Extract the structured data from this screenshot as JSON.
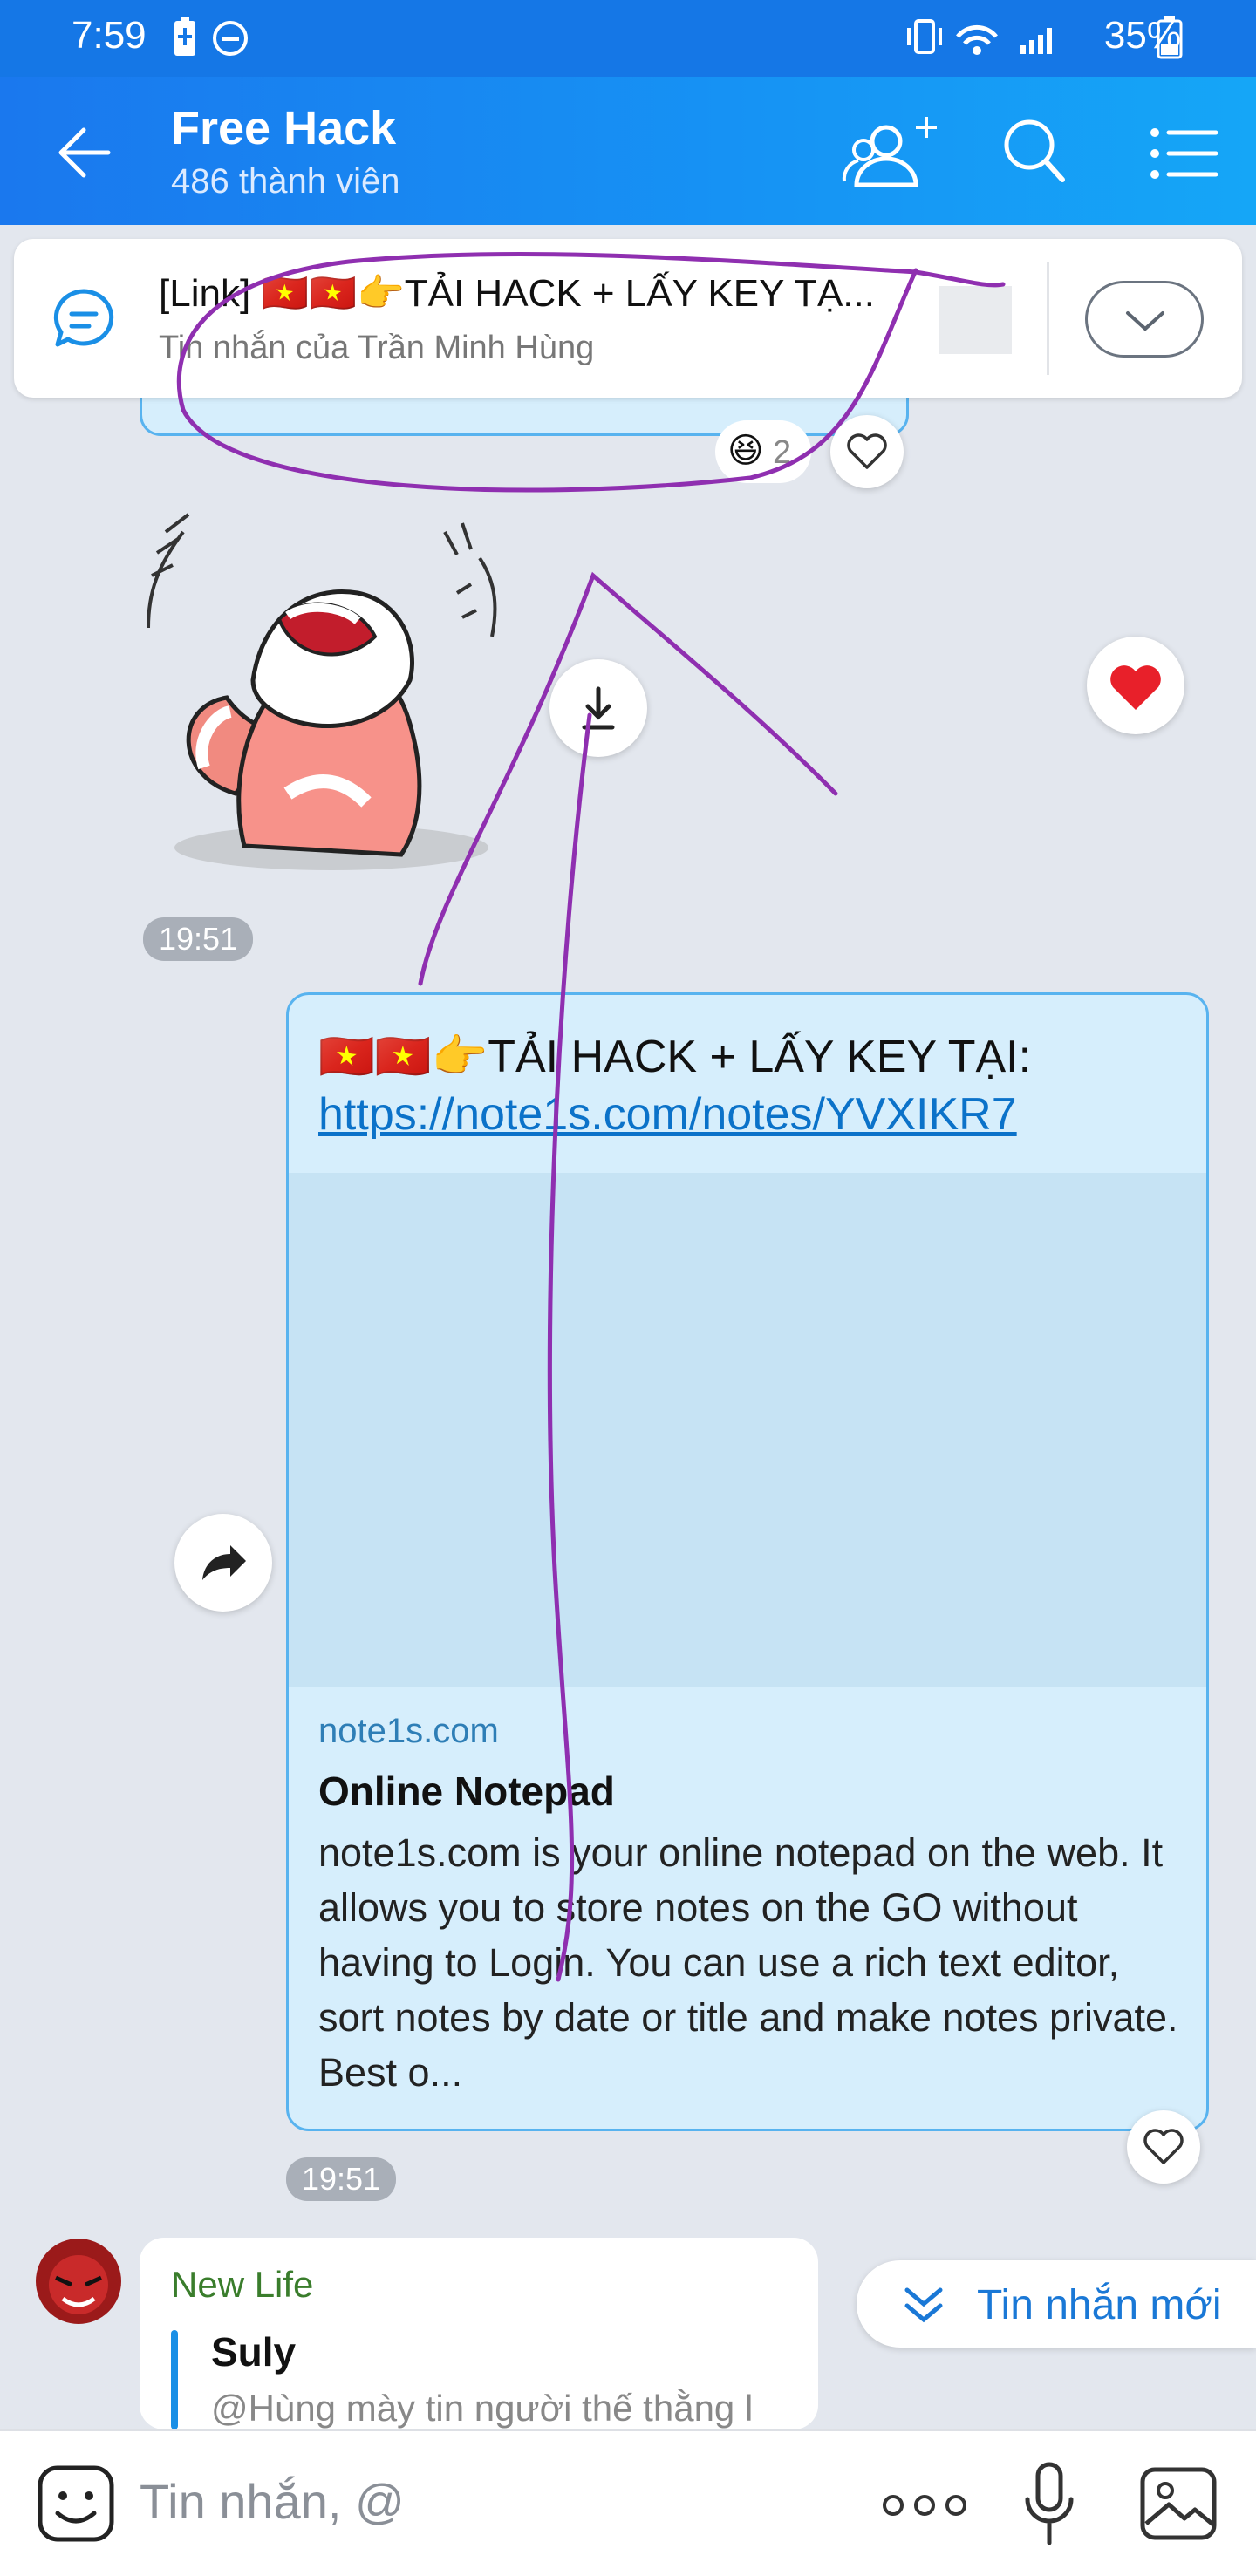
{
  "status_bar": {
    "time": "7:59",
    "battery": "35%"
  },
  "header": {
    "title": "Free Hack",
    "subtitle": "486 thành viên"
  },
  "pinned": {
    "title": "[Link] 🇻🇳🇻🇳👉TẢI HACK + LẤY KEY TẠ...",
    "subtitle": "Tin nhắn của Trần Minh Hùng"
  },
  "prev_message": {
    "reaction_count": "2"
  },
  "sticker_message": {
    "time": "19:51"
  },
  "link_message": {
    "text": "🇻🇳🇻🇳👉TẢI HACK + LẤY KEY TẠI:",
    "url": "https://note1s.com/notes/YVXIKR7",
    "preview_domain": "note1s.com",
    "preview_title": "Online Notepad",
    "preview_description": "note1s.com is your online notepad on the web. It allows you to store notes on the GO without having to Login. You can use a rich text editor, sort notes by date or title and make notes private. Best o...",
    "time": "19:51"
  },
  "reply_message": {
    "sender": "New Life",
    "quoted_name": "Suly",
    "quoted_text": "@Hùng mày tin người thế thằng l"
  },
  "new_messages_button": {
    "label": "Tin nhắn mới"
  },
  "composer": {
    "placeholder": "Tin nhắn, @"
  },
  "colors": {
    "header": "#1a78ee",
    "accent": "#1a8fe6",
    "annotation": "#8f2fb0",
    "heart": "#e8202a"
  },
  "icons": [
    "back-arrow-icon",
    "add-member-icon",
    "search-icon",
    "menu-icon",
    "chat-bubble-icon",
    "chevron-down-icon",
    "heart-icon",
    "laugh-emoji-icon",
    "download-icon",
    "share-icon",
    "double-chevron-down-icon",
    "sticker-icon",
    "more-icon",
    "mic-icon",
    "image-icon"
  ]
}
